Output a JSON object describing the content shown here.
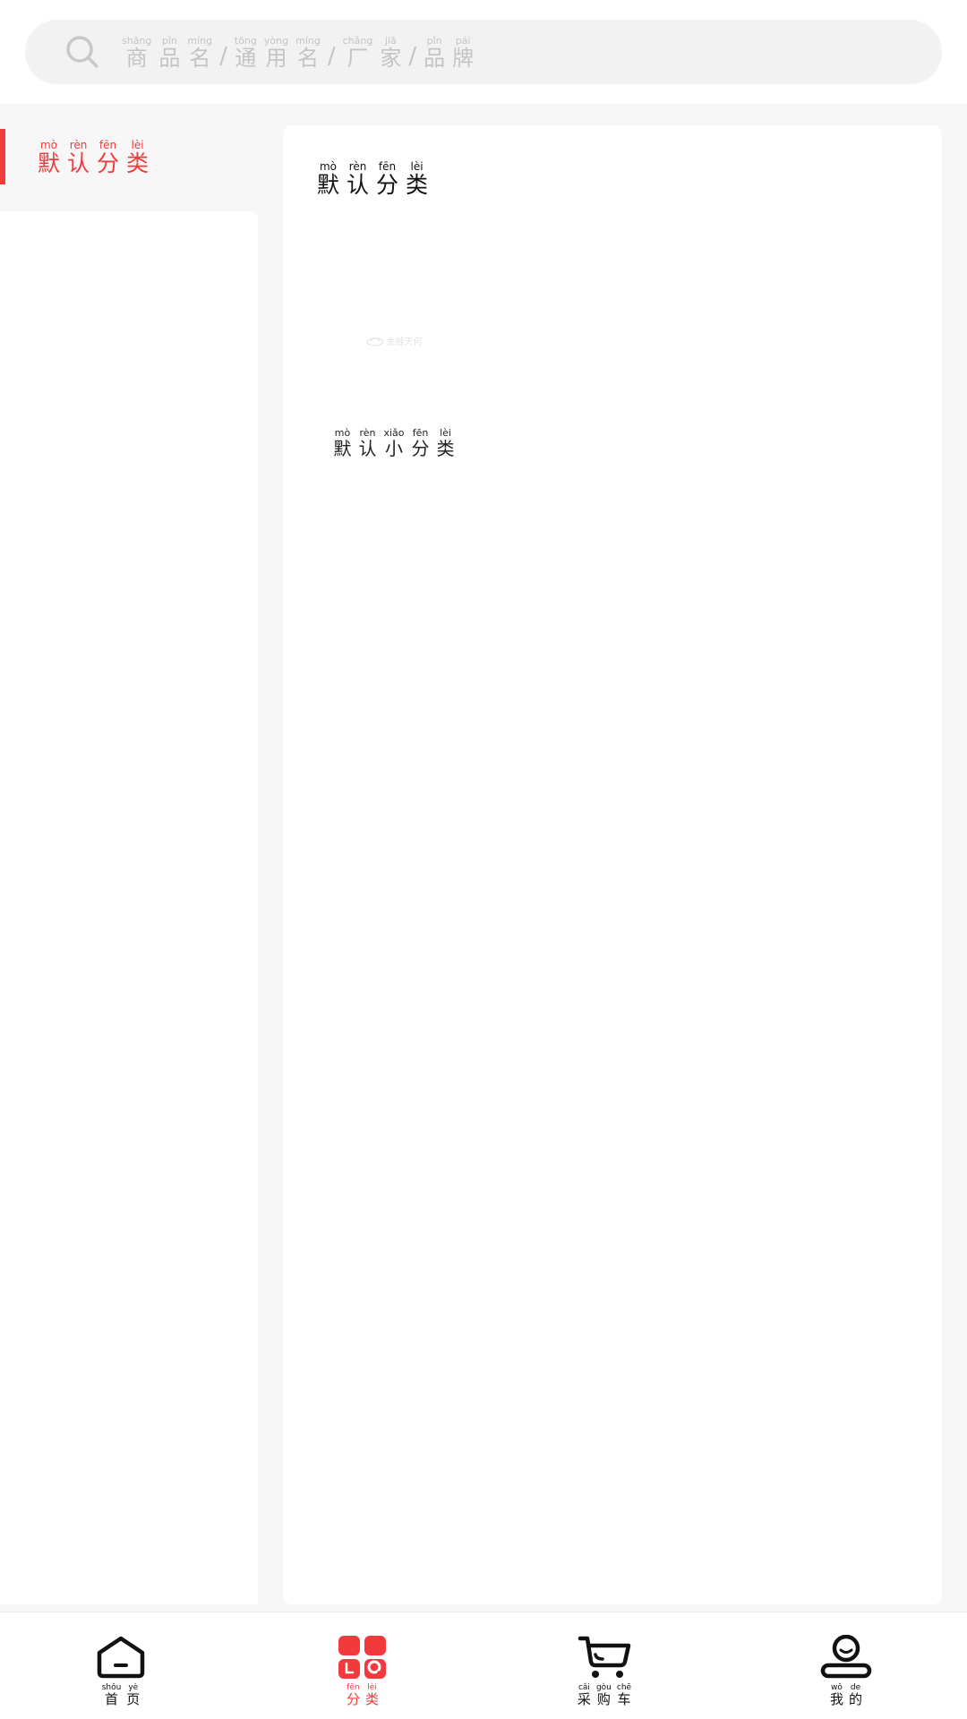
{
  "search": {
    "icon": "search-icon",
    "placeholder": [
      {
        "type": "char",
        "pinyin": "shāng",
        "char": "商"
      },
      {
        "type": "char",
        "pinyin": "pǐn",
        "char": "品"
      },
      {
        "type": "char",
        "pinyin": "míng",
        "char": "名"
      },
      {
        "type": "sep",
        "char": "/"
      },
      {
        "type": "char",
        "pinyin": "tōng",
        "char": "通"
      },
      {
        "type": "char",
        "pinyin": "yòng",
        "char": "用"
      },
      {
        "type": "char",
        "pinyin": "míng",
        "char": "名"
      },
      {
        "type": "sep",
        "char": "/"
      },
      {
        "type": "char",
        "pinyin": "chǎng",
        "char": "厂"
      },
      {
        "type": "char",
        "pinyin": "jiā",
        "char": "家"
      },
      {
        "type": "sep",
        "char": "/"
      },
      {
        "type": "char",
        "pinyin": "pǐn",
        "char": "品"
      },
      {
        "type": "char",
        "pinyin": "pái",
        "char": "牌"
      }
    ]
  },
  "sidebar": {
    "active_category": [
      {
        "pinyin": "mò",
        "char": "默"
      },
      {
        "pinyin": "rèn",
        "char": "认"
      },
      {
        "pinyin": "fēn",
        "char": "分"
      },
      {
        "pinyin": "lèi",
        "char": "类"
      }
    ]
  },
  "content": {
    "section_title": [
      {
        "pinyin": "mò",
        "char": "默"
      },
      {
        "pinyin": "rèn",
        "char": "认"
      },
      {
        "pinyin": "fēn",
        "char": "分"
      },
      {
        "pinyin": "lèi",
        "char": "类"
      }
    ],
    "sub_categories": [
      {
        "image_placeholder": "logo-placeholder-icon",
        "logo_text": "金蛙天何",
        "label": [
          {
            "pinyin": "mò",
            "char": "默"
          },
          {
            "pinyin": "rèn",
            "char": "认"
          },
          {
            "pinyin": "xiǎo",
            "char": "小"
          },
          {
            "pinyin": "fēn",
            "char": "分"
          },
          {
            "pinyin": "lèi",
            "char": "类"
          }
        ]
      }
    ]
  },
  "tabbar": {
    "accent_color": "#f23a3c",
    "active_index": 1,
    "tabs": [
      {
        "icon": "home-icon",
        "label": [
          {
            "pinyin": "shǒu",
            "char": "首"
          },
          {
            "pinyin": "yè",
            "char": "页"
          }
        ]
      },
      {
        "icon": "category-icon",
        "label": [
          {
            "pinyin": "fēn",
            "char": "分"
          },
          {
            "pinyin": "lèi",
            "char": "类"
          }
        ]
      },
      {
        "icon": "cart-icon",
        "label": [
          {
            "pinyin": "cǎi",
            "char": "采"
          },
          {
            "pinyin": "gòu",
            "char": "购"
          },
          {
            "pinyin": "chē",
            "char": "车"
          }
        ]
      },
      {
        "icon": "profile-icon",
        "label": [
          {
            "pinyin": "wǒ",
            "char": "我"
          },
          {
            "pinyin": "de",
            "char": "的"
          }
        ]
      }
    ]
  }
}
